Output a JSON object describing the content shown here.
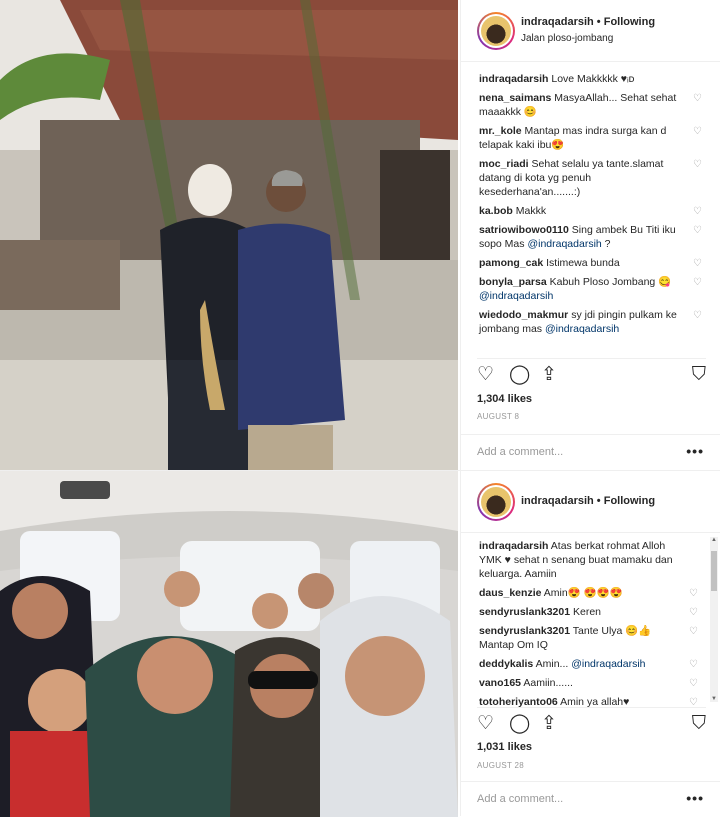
{
  "post1": {
    "username": "indraqadarsih",
    "dot": " • ",
    "follow_label": "Following",
    "location": "Jalan ploso-jombang",
    "comments": [
      {
        "user": "indraqadarsih",
        "text": " Love Makkkkk ♥ᵢᴅ"
      },
      {
        "user": "nena_saimans",
        "text": " MasyaAllah... Sehat sehat maaakkk 😊"
      },
      {
        "user": "mr._kole",
        "text": " Mantap mas indra surga kan d telapak kaki ibu😍"
      },
      {
        "user": "moc_riadi",
        "text": " Sehat selalu ya tante.slamat datang di kota yg penuh kesederhana'an.......:)"
      },
      {
        "user": "ka.bob",
        "text": " Makkk"
      },
      {
        "user": "satriowibowo0110",
        "text": " Sing ambek Bu Titi iku sopo Mas ",
        "mention": "@indraqadarsih",
        "tail": " ?"
      },
      {
        "user": "pamong_cak",
        "text": " Istimewa bunda"
      },
      {
        "user": "bonyla_parsa",
        "text": " Kabuh Ploso Jombang 😋 ",
        "mention": "@indraqadarsih",
        "tail": ""
      },
      {
        "user": "wiedodo_makmur",
        "text": " sy jdi pingin pulkam ke jombang mas ",
        "mention": "@indraqadarsih",
        "tail": ""
      }
    ],
    "likes": "1,304 likes",
    "date": "AUGUST 8",
    "add_comment_placeholder": "Add a comment...",
    "more": "•••"
  },
  "post2": {
    "username": "indraqadarsih",
    "dot": " • ",
    "follow_label": "Following",
    "comments": [
      {
        "user": "indraqadarsih",
        "text": " Atas berkat rohmat Alloh YMK ♥ sehat n senang buat mamaku dan keluarga. Aamiin"
      },
      {
        "user": "daus_kenzie",
        "text": " Amin😍 😍😍😍"
      },
      {
        "user": "sendyruslank3201",
        "text": " Keren"
      },
      {
        "user": "sendyruslank3201",
        "text": " Tante Ulya 😊👍 Mantap Om IQ"
      },
      {
        "user": "deddykalis",
        "text": " Amin... ",
        "mention": "@indraqadarsih",
        "tail": ""
      },
      {
        "user": "vano165",
        "text": " Aamiin......"
      },
      {
        "user": "totoheriyanto06",
        "text": " Amin ya allah♥"
      }
    ],
    "likes": "1,031 likes",
    "date": "AUGUST 28",
    "add_comment_placeholder": "Add a comment...",
    "more": "•••"
  },
  "icons": {
    "like": "heart-outline-icon",
    "comment": "comment-bubble-icon",
    "share": "share-icon",
    "save": "bookmark-icon"
  }
}
